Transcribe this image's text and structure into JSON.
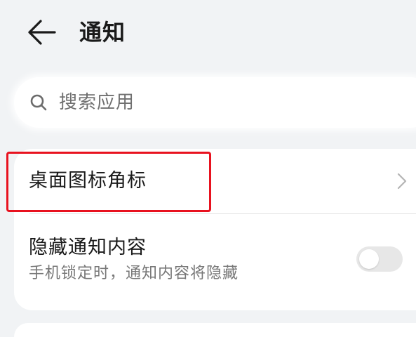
{
  "header": {
    "title": "通知",
    "back_icon": "arrow-left-icon"
  },
  "search": {
    "placeholder": "搜索应用",
    "icon": "search-icon"
  },
  "settings": {
    "badge_row": {
      "label": "桌面图标角标",
      "icon": "chevron-right-icon",
      "highlighted": true,
      "highlight_color": "#e8121f"
    },
    "hide_content_row": {
      "title": "隐藏通知内容",
      "subtitle": "手机锁定时，通知内容将隐藏",
      "toggle_on": false
    }
  },
  "colors": {
    "background": "#f1f3f5",
    "card": "#ffffff",
    "primary_text": "#1a1a1a",
    "secondary_text": "#777777",
    "toggle_off": "#e7e7e7"
  }
}
